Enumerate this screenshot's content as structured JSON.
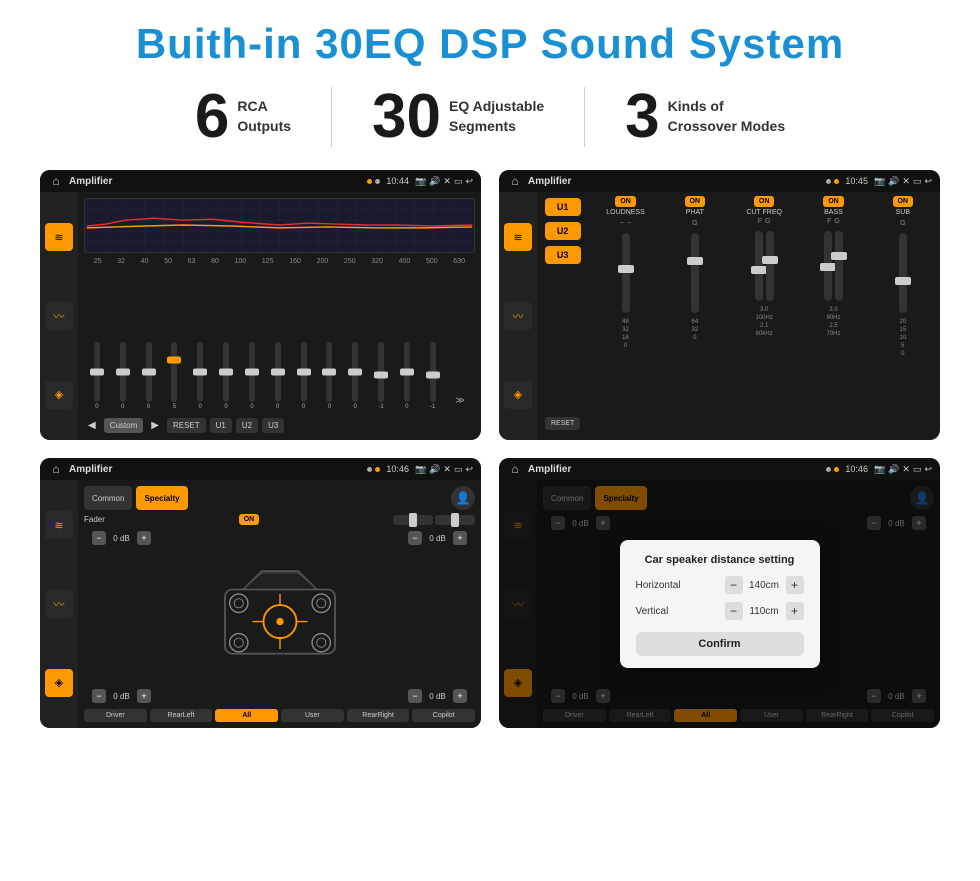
{
  "page": {
    "title": "Buith-in 30EQ DSP Sound System",
    "stats": [
      {
        "number": "6",
        "label": "RCA\nOutputs"
      },
      {
        "number": "30",
        "label": "EQ Adjustable\nSegments"
      },
      {
        "number": "3",
        "label": "Kinds of\nCrossover Modes"
      }
    ]
  },
  "screen1": {
    "statusBar": {
      "appName": "Amplifier",
      "time": "10:44"
    },
    "freqLabels": [
      "25",
      "32",
      "40",
      "50",
      "63",
      "80",
      "100",
      "125",
      "160",
      "200",
      "250",
      "320",
      "400",
      "500",
      "630"
    ],
    "sliderValues": [
      "0",
      "0",
      "0",
      "5",
      "0",
      "0",
      "0",
      "0",
      "0",
      "0",
      "0",
      "-1",
      "0",
      "-1"
    ],
    "buttons": [
      "Custom",
      "RESET",
      "U1",
      "U2",
      "U3"
    ]
  },
  "screen2": {
    "statusBar": {
      "appName": "Amplifier",
      "time": "10:45"
    },
    "uButtons": [
      "U1",
      "U2",
      "U3"
    ],
    "channels": [
      {
        "name": "LOUDNESS",
        "on": true
      },
      {
        "name": "PHAT",
        "on": true
      },
      {
        "name": "CUT FREQ",
        "on": true
      },
      {
        "name": "BASS",
        "on": true
      },
      {
        "name": "SUB",
        "on": true
      }
    ],
    "resetLabel": "RESET"
  },
  "screen3": {
    "statusBar": {
      "appName": "Amplifier",
      "time": "10:46"
    },
    "tabs": [
      "Common",
      "Specialty"
    ],
    "faderLabel": "Fader",
    "faderOn": "ON",
    "dbValues": [
      "0 dB",
      "0 dB",
      "0 dB",
      "0 dB"
    ],
    "bottomButtons": [
      "Driver",
      "RearLeft",
      "All",
      "User",
      "RearRight",
      "Copilot"
    ]
  },
  "screen4": {
    "statusBar": {
      "appName": "Amplifier",
      "time": "10:46"
    },
    "tabs": [
      "Common",
      "Specialty"
    ],
    "dialog": {
      "title": "Car speaker distance setting",
      "horizontalLabel": "Horizontal",
      "horizontalValue": "140cm",
      "verticalLabel": "Vertical",
      "verticalValue": "110cm",
      "confirmLabel": "Confirm"
    },
    "dbValues": [
      "0 dB",
      "0 dB"
    ],
    "bottomButtons": [
      "Driver",
      "RearLeft",
      "All",
      "RearRight",
      "Copilot"
    ]
  },
  "icons": {
    "home": "⌂",
    "back": "↩",
    "location": "📍",
    "camera": "📷",
    "volume": "🔊",
    "close": "✕",
    "window": "▭",
    "eq": "≋",
    "wave": "〰",
    "speaker": "◈",
    "person": "👤",
    "minus": "−",
    "plus": "+"
  }
}
